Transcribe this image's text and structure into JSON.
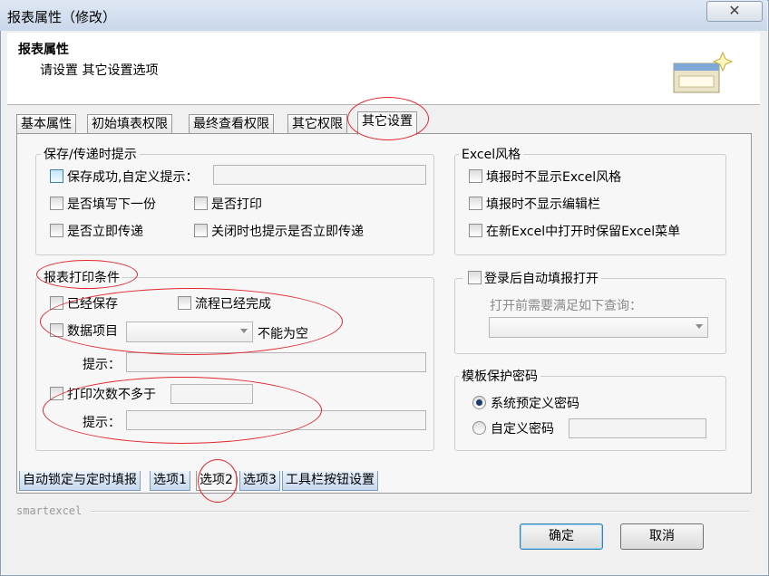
{
  "window": {
    "title": "报表属性（修改）",
    "close_glyph": "✕"
  },
  "header": {
    "title": "报表属性",
    "subtitle": "请设置 其它设置选项",
    "icon": "window-sparkle-icon"
  },
  "tabs": [
    "基本属性",
    "初始填表权限",
    "最终查看权限",
    "其它权限",
    "其它设置"
  ],
  "save_prompt": {
    "legend": "保存/传递时提示",
    "save_success": "保存成功,自定义提示：",
    "fill_next": "是否填写下一份",
    "print_q": "是否打印",
    "send_now": "是否立即传递",
    "close_prompt": "关闭时也提示是否立即传递"
  },
  "excel_style": {
    "legend": "Excel风格",
    "no_style": "填报时不显示Excel风格",
    "no_editbar": "填报时不显示编辑栏",
    "keep_menu": "在新Excel中打开时保留Excel菜单"
  },
  "print_cond": {
    "legend": "报表打印条件",
    "saved": "已经保存",
    "flow_done": "流程已经完成",
    "data_item": "数据项目",
    "not_empty": "不能为空",
    "hint1": "提示：",
    "print_limit": "打印次数不多于",
    "hint2": "提示："
  },
  "auto_open": {
    "label": "登录后自动填报打开",
    "query_label": "打开前需要满足如下查询："
  },
  "tpl_password": {
    "legend": "模板保护密码",
    "system": "系统预定义密码",
    "custom": "自定义密码"
  },
  "bottom_tabs": [
    "自动锁定与定时填报",
    "选项1",
    "选项2",
    "选项3",
    "工具栏按钮设置"
  ],
  "footer": {
    "brand": "smartexcel",
    "ok": "确定",
    "cancel": "取消"
  },
  "colors": {
    "annotation": "#e2262b",
    "title_bar": "#c9d7ea",
    "bottom_tab": "#c6d8ee"
  }
}
